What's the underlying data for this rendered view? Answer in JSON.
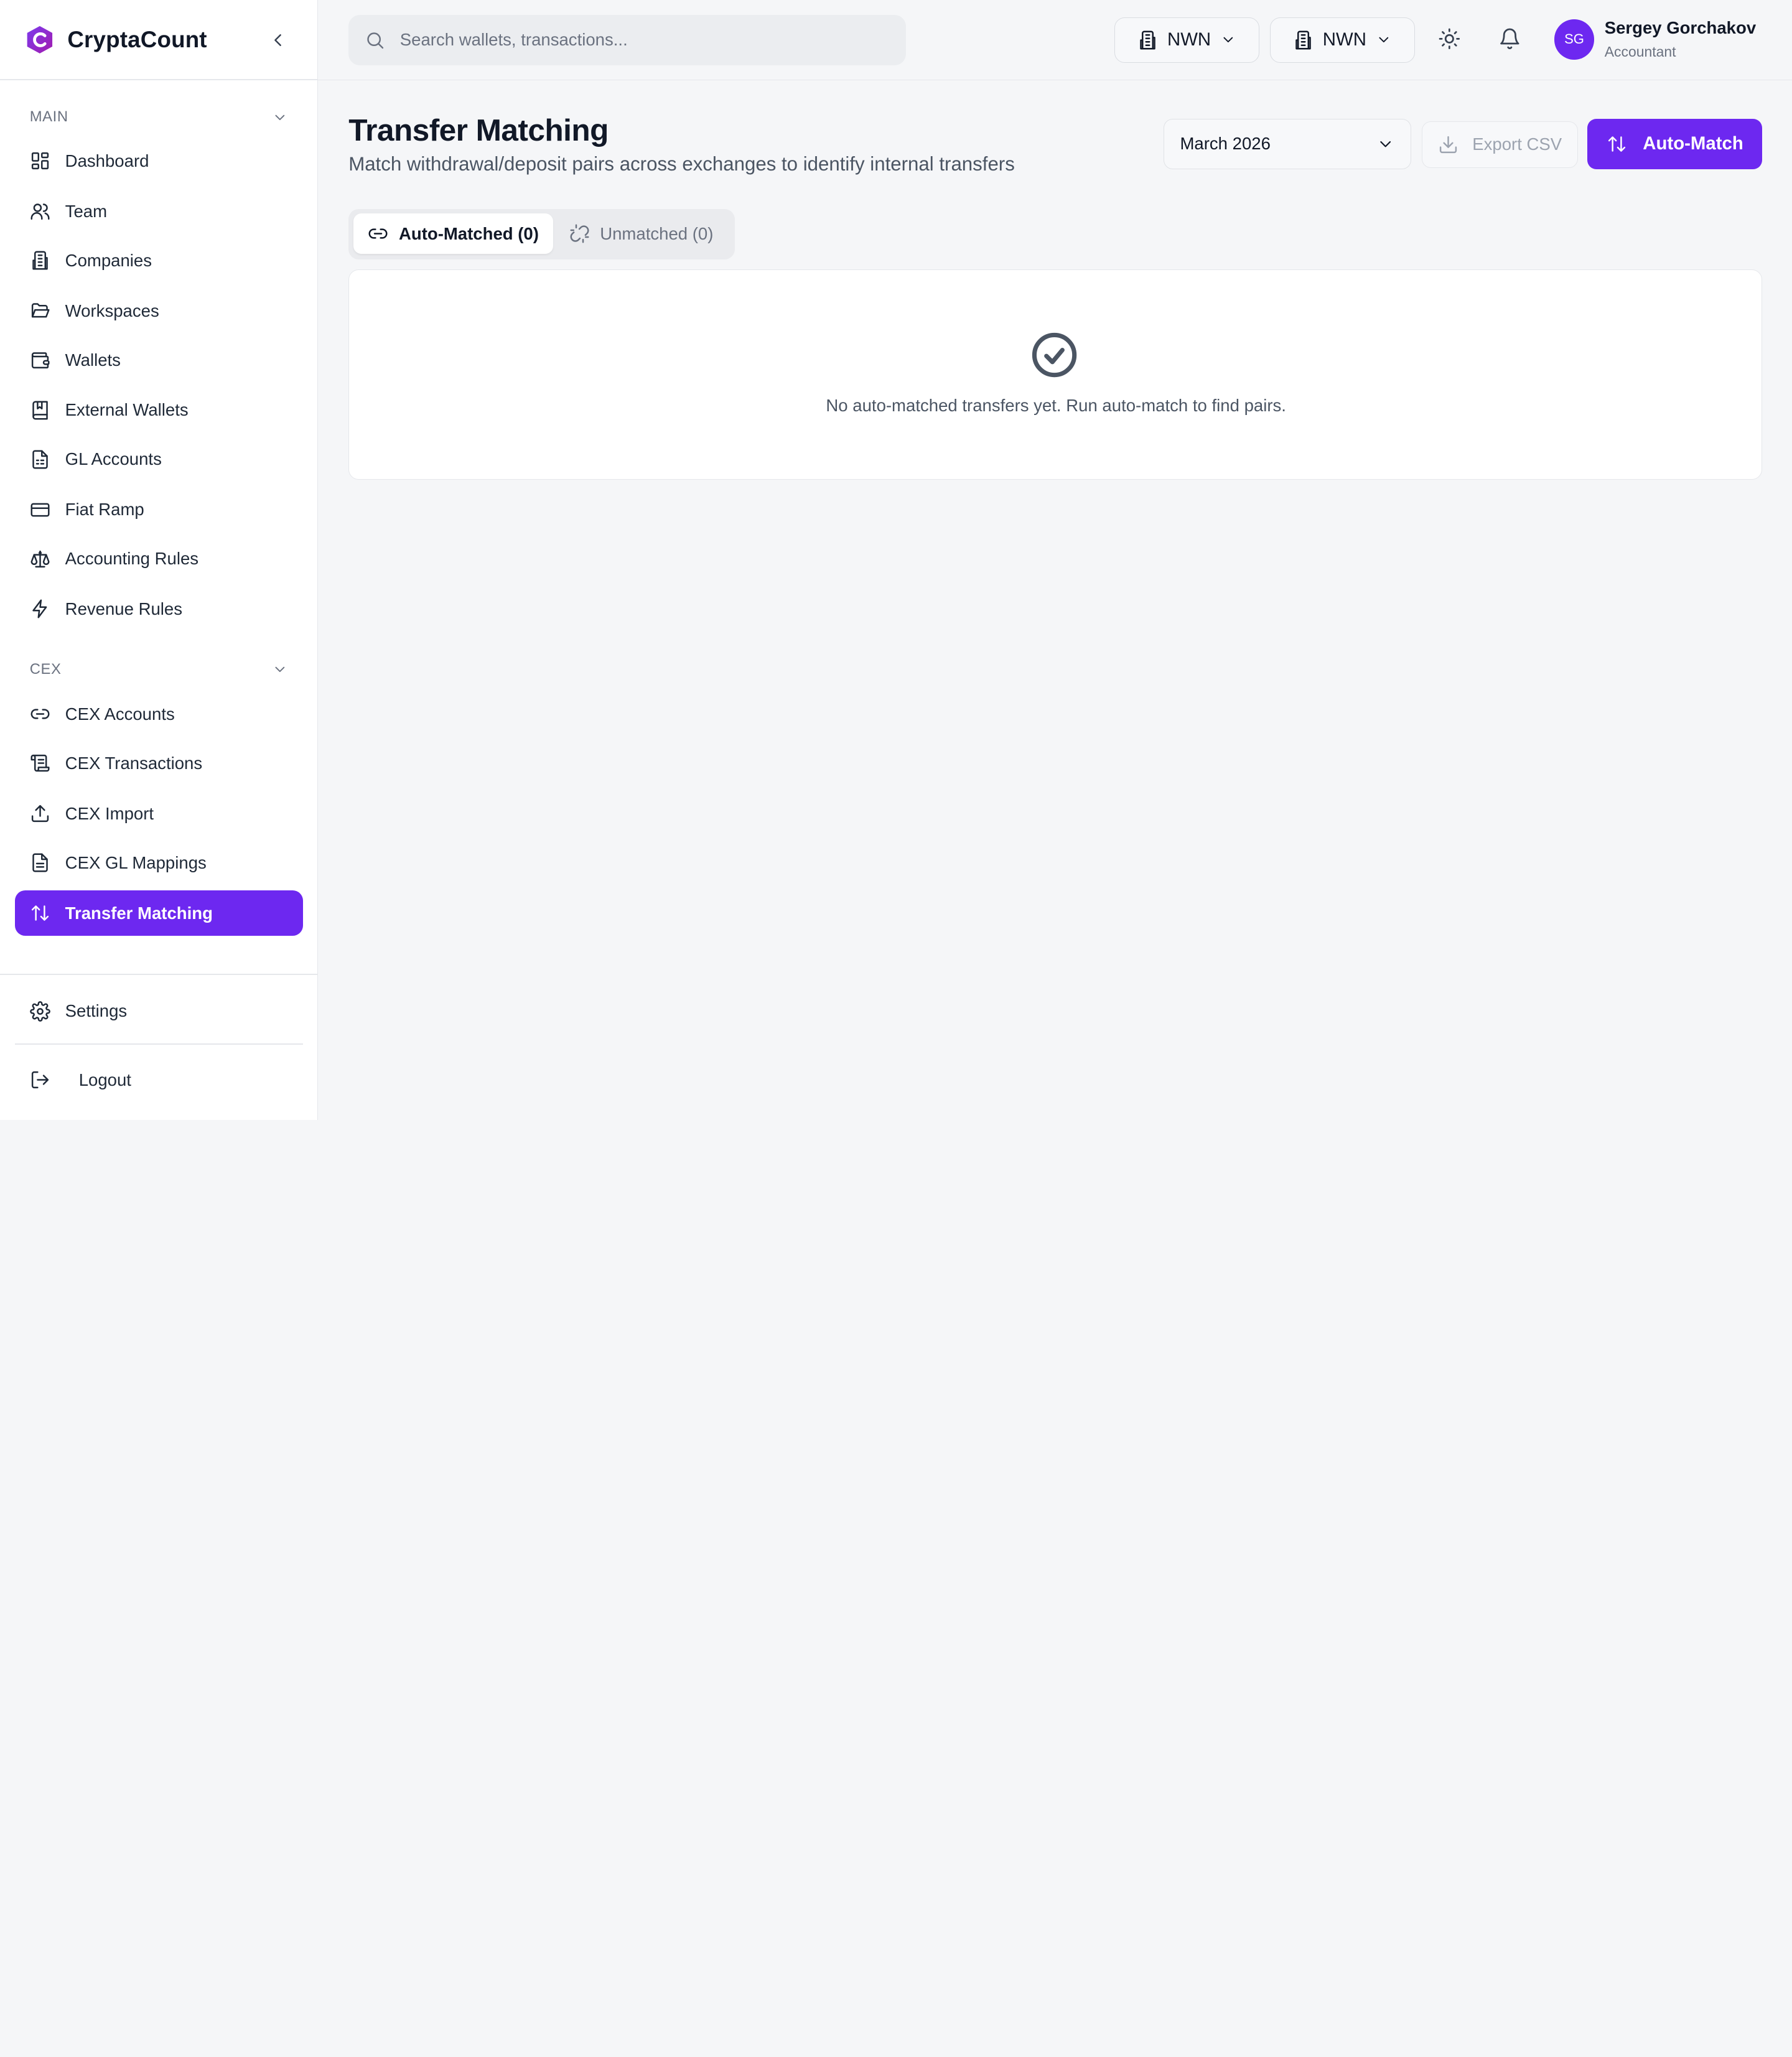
{
  "app": {
    "name": "CryptaCount"
  },
  "sidebar": {
    "sections": [
      {
        "label": "MAIN"
      },
      {
        "label": "CEX"
      }
    ],
    "main_items": [
      {
        "label": "Dashboard",
        "icon": "dashboard-icon"
      },
      {
        "label": "Team",
        "icon": "team-icon"
      },
      {
        "label": "Companies",
        "icon": "building-icon"
      },
      {
        "label": "Workspaces",
        "icon": "folder-icon"
      },
      {
        "label": "Wallets",
        "icon": "wallet-icon"
      },
      {
        "label": "External Wallets",
        "icon": "book-icon"
      },
      {
        "label": "GL Accounts",
        "icon": "document-icon"
      },
      {
        "label": "Fiat Ramp",
        "icon": "card-icon"
      },
      {
        "label": "Accounting Rules",
        "icon": "scale-icon"
      },
      {
        "label": "Revenue Rules",
        "icon": "bolt-icon"
      }
    ],
    "cex_items": [
      {
        "label": "CEX Accounts",
        "icon": "link-icon"
      },
      {
        "label": "CEX Transactions",
        "icon": "scroll-icon"
      },
      {
        "label": "CEX Import",
        "icon": "upload-icon"
      },
      {
        "label": "CEX GL Mappings",
        "icon": "document-icon"
      },
      {
        "label": "Transfer Matching",
        "icon": "arrows-up-down-icon",
        "active": true
      }
    ],
    "settings": "Settings",
    "logout": "Logout"
  },
  "header": {
    "search_placeholder": "Search wallets, transactions...",
    "company_selector": "NWN",
    "workspace_selector": "NWN",
    "user": {
      "initials": "SG",
      "name": "Sergey Gorchakov",
      "role": "Accountant"
    }
  },
  "page": {
    "title": "Transfer Matching",
    "subtitle": "Match withdrawal/deposit pairs across exchanges to identify internal transfers",
    "month": "March 2026",
    "export_label": "Export CSV",
    "automatch_label": "Auto-Match",
    "tabs": [
      {
        "label": "Auto-Matched (0)",
        "active": true
      },
      {
        "label": "Unmatched (0)",
        "active": false
      }
    ],
    "empty_message": "No auto-matched transfers yet. Run auto-match to find pairs."
  },
  "colors": {
    "accent": "#6d28f0",
    "text": "#111827",
    "muted": "#6b7280",
    "background": "#f5f6f8"
  }
}
